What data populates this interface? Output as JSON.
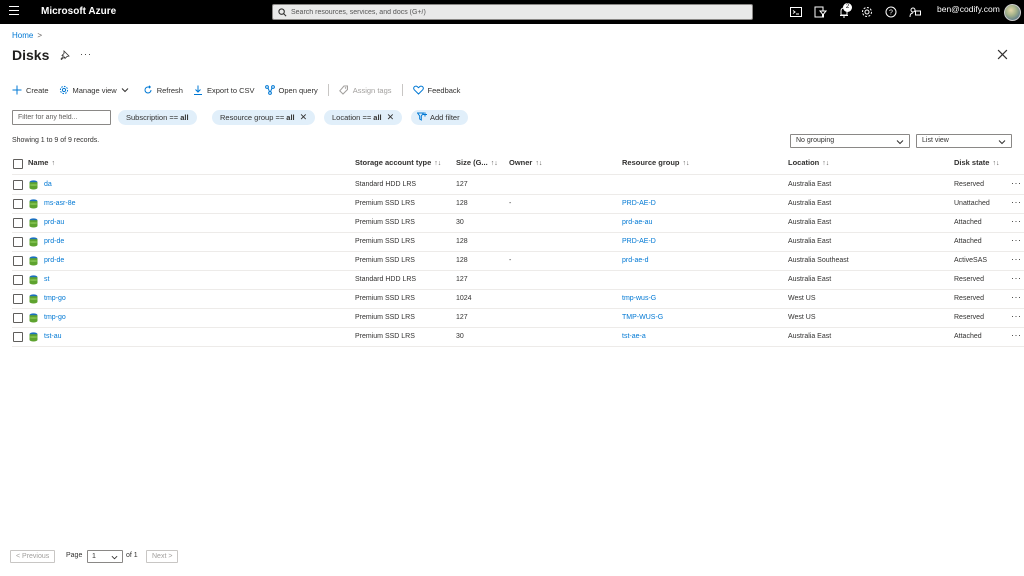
{
  "topbar": {
    "brand": "Microsoft Azure",
    "search_placeholder": "Search resources, services, and docs (G+/)",
    "notification_count": "2",
    "user": "ben@codify.com"
  },
  "breadcrumb": {
    "home": "Home",
    "separator": ">"
  },
  "page": {
    "title": "Disks",
    "more": "···"
  },
  "toolbar": {
    "create": "Create",
    "manage_view": "Manage view",
    "refresh": "Refresh",
    "export_csv": "Export to CSV",
    "open_query": "Open query",
    "assign_tags": "Assign tags",
    "feedback": "Feedback"
  },
  "filters": {
    "field_placeholder": "Filter for any field...",
    "subscription_label": "Subscription == ",
    "subscription_value": "all",
    "resource_group_label": "Resource group == ",
    "resource_group_value": "all",
    "location_label": "Location == ",
    "location_value": "all",
    "add_filter": "Add filter"
  },
  "records_text": "Showing 1 to 9 of 9 records.",
  "grouping": "No grouping",
  "view": "List view",
  "columns": {
    "name": "Name",
    "storage": "Storage account type",
    "size": "Size (G...",
    "owner": "Owner",
    "resource_group": "Resource group",
    "location": "Location",
    "disk_state": "Disk state",
    "sort_icon": "↑↓",
    "sort_asc": "↑"
  },
  "rows": [
    {
      "name": "da",
      "storage": "Standard HDD LRS",
      "size": "127",
      "owner": "",
      "rg": "",
      "location": "Australia East",
      "state": "Reserved"
    },
    {
      "name": "ms-asr-8e",
      "storage": "Premium SSD LRS",
      "size": "128",
      "owner": "-",
      "rg": "PRD-AE-D",
      "location": "Australia East",
      "state": "Unattached"
    },
    {
      "name": "prd-au",
      "storage": "Premium SSD LRS",
      "size": "30",
      "owner": "",
      "rg": "prd-ae-au",
      "location": "Australia East",
      "state": "Attached"
    },
    {
      "name": "prd-de",
      "storage": "Premium SSD LRS",
      "size": "128",
      "owner": "",
      "rg": "PRD-AE-D",
      "location": "Australia East",
      "state": "Attached"
    },
    {
      "name": "prd-de",
      "storage": "Premium SSD LRS",
      "size": "128",
      "owner": "-",
      "rg": "prd-ae-d",
      "location": "Australia Southeast",
      "state": "ActiveSAS"
    },
    {
      "name": "st",
      "storage": "Standard HDD LRS",
      "size": "127",
      "owner": "",
      "rg": "",
      "location": "Australia East",
      "state": "Reserved"
    },
    {
      "name": "tmp-go",
      "storage": "Premium SSD LRS",
      "size": "1024",
      "owner": "",
      "rg": "tmp-wus-G",
      "location": "West US",
      "state": "Reserved"
    },
    {
      "name": "tmp-go",
      "storage": "Premium SSD LRS",
      "size": "127",
      "owner": "",
      "rg": "TMP-WUS-G",
      "location": "West US",
      "state": "Reserved"
    },
    {
      "name": "tst-au",
      "storage": "Premium SSD LRS",
      "size": "30",
      "owner": "",
      "rg": "tst-ae-a",
      "location": "Australia East",
      "state": "Attached"
    }
  ],
  "row_more": "···",
  "pagination": {
    "previous": "< Previous",
    "page_label": "Page",
    "page_value": "1",
    "of": "of 1",
    "next": "Next >"
  },
  "icons": {
    "menu": "hamburger-icon",
    "search": "search-icon",
    "cloud_shell": "cloud-shell-icon",
    "directory": "directory-filter-icon",
    "notifications": "bell-icon",
    "settings": "gear-icon",
    "help": "help-icon",
    "feedback": "feedback-icon",
    "pin": "pin-icon",
    "close": "close-icon",
    "disk": "disk-icon"
  },
  "colors": {
    "accent": "#0078d4",
    "topbar": "#000000",
    "pill": "#e1effa",
    "disk_green": "#5ea32f",
    "disk_blue": "#1a6fbf"
  }
}
